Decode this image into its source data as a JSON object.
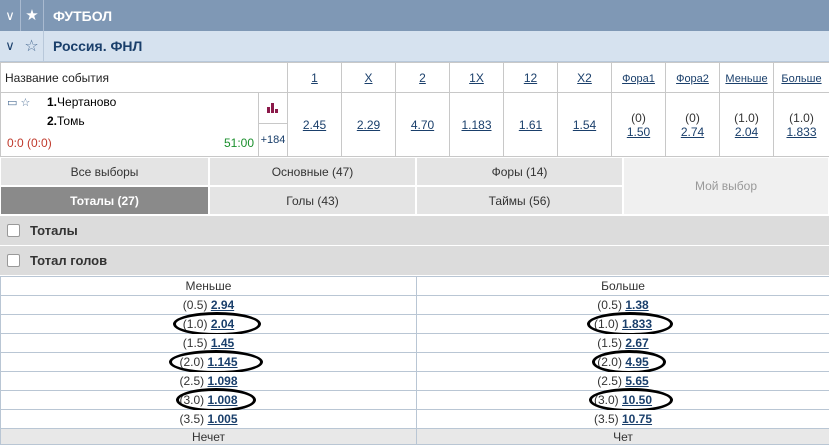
{
  "sport": {
    "title": "ФУТБОЛ"
  },
  "league": {
    "title": "Россия. ФНЛ"
  },
  "header": {
    "event_name": "Название события",
    "cols": [
      "1",
      "X",
      "2",
      "1X",
      "12",
      "X2",
      "Фора1",
      "Фора2",
      "Меньше",
      "Больше"
    ]
  },
  "event": {
    "team1_num": "1.",
    "team1": "Чертаново",
    "team2_num": "2.",
    "team2": "Томь",
    "score": "0:0 (0:0)",
    "time": "51:00",
    "more": "+184",
    "odds": [
      "2.45",
      "2.29",
      "4.70",
      "1.183",
      "1.61",
      "1.54"
    ],
    "fora1": {
      "p": "(0)",
      "v": "1.50"
    },
    "fora2": {
      "p": "(0)",
      "v": "2.74"
    },
    "under": {
      "p": "(1.0)",
      "v": "2.04"
    },
    "over": {
      "p": "(1.0)",
      "v": "1.833"
    }
  },
  "tabs": {
    "all": "Все выборы",
    "main": "Основные (47)",
    "fora": "Форы (14)",
    "mine": "Мой выбор",
    "totals": "Тоталы (27)",
    "goals": "Голы (43)",
    "halves": "Таймы (56)"
  },
  "sections": {
    "totals": "Тоталы",
    "total_goals": "Тотал голов"
  },
  "totals_table": {
    "left_header": "Меньше",
    "right_header": "Больше",
    "rows": [
      {
        "lp": "(0.5)",
        "lv": "2.94",
        "rp": "(0.5)",
        "rv": "1.38"
      },
      {
        "lp": "(1.0)",
        "lv": "2.04",
        "rp": "(1.0)",
        "rv": "1.833"
      },
      {
        "lp": "(1.5)",
        "lv": "1.45",
        "rp": "(1.5)",
        "rv": "2.67"
      },
      {
        "lp": "(2.0)",
        "lv": "1.145",
        "rp": "(2.0)",
        "rv": "4.95"
      },
      {
        "lp": "(2.5)",
        "lv": "1.098",
        "rp": "(2.5)",
        "rv": "5.65"
      },
      {
        "lp": "(3.0)",
        "lv": "1.008",
        "rp": "(3.0)",
        "rv": "10.50"
      },
      {
        "lp": "(3.5)",
        "lv": "1.005",
        "rp": "(3.5)",
        "rv": "10.75"
      }
    ],
    "bottom_left": "Нечет",
    "bottom_right": "Чет"
  }
}
